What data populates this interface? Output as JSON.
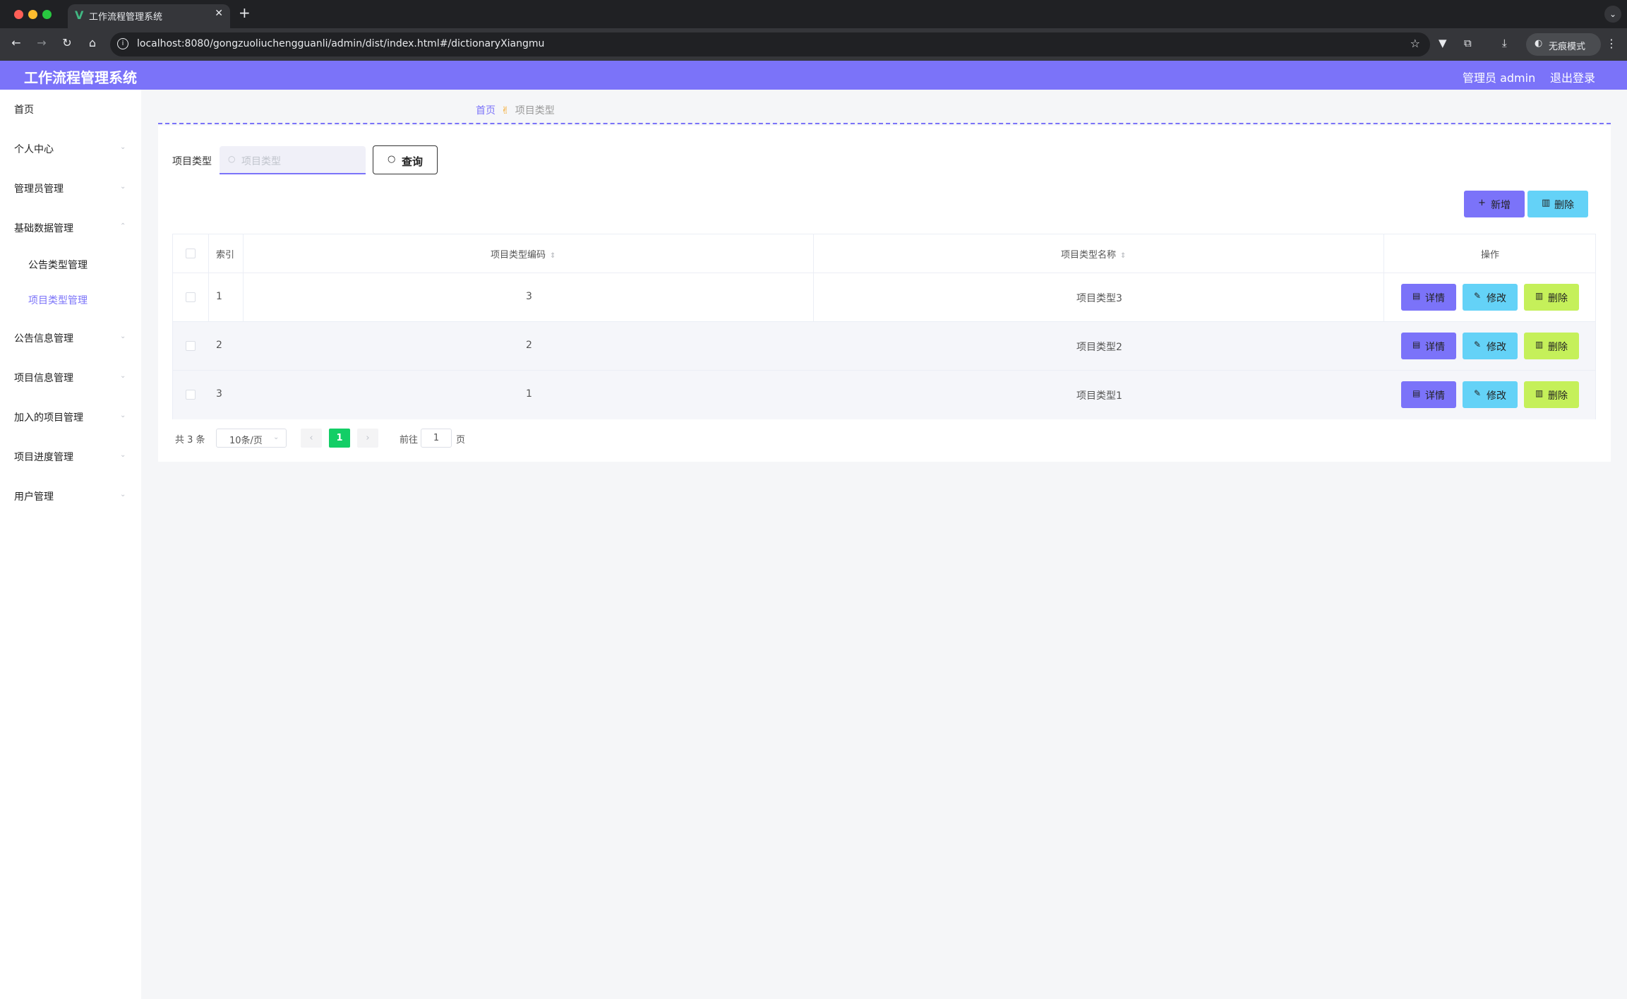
{
  "browser": {
    "tab_title": "工作流程管理系统",
    "tab_logo": "V",
    "url": "localhost:8080/gongzuoliuchengguanli/admin/dist/index.html#/dictionaryXiangmu",
    "incognito_label": "无痕模式"
  },
  "header": {
    "title": "工作流程管理系统",
    "user": "管理员 admin",
    "logout": "退出登录",
    "color": "#7b73f9"
  },
  "sidebar": {
    "items": [
      {
        "label": "首页"
      },
      {
        "label": "个人中心"
      },
      {
        "label": "管理员管理"
      },
      {
        "label": "基础数据管理",
        "expanded": true
      },
      {
        "label": "公告信息管理"
      },
      {
        "label": "项目信息管理"
      },
      {
        "label": "加入的项目管理"
      },
      {
        "label": "项目进度管理"
      },
      {
        "label": "用户管理"
      }
    ],
    "sub_items": [
      {
        "label": "公告类型管理"
      },
      {
        "label": "项目类型管理",
        "active": true
      }
    ]
  },
  "breadcrumb": {
    "home": "首页",
    "separator": "✌",
    "current": "项目类型"
  },
  "search": {
    "label": "项目类型",
    "placeholder": "项目类型",
    "button": "查询"
  },
  "toolbar": {
    "add_label": "新增",
    "delete_label": "删除"
  },
  "table": {
    "columns": [
      "索引",
      "项目类型编码",
      "项目类型名称",
      "操作"
    ],
    "rows": [
      {
        "index": "1",
        "code": "3",
        "name": "项目类型3"
      },
      {
        "index": "2",
        "code": "2",
        "name": "项目类型2"
      },
      {
        "index": "3",
        "code": "1",
        "name": "项目类型1"
      }
    ],
    "actions": {
      "detail": "详情",
      "edit": "修改",
      "delete": "删除"
    }
  },
  "pagination": {
    "total": "共 3 条",
    "page_size": "10条/页",
    "current_page": "1",
    "goto_prefix": "前往",
    "goto_value": "1",
    "goto_suffix": "页"
  },
  "colors": {
    "primary": "#7b73f9",
    "info": "#64d2f7",
    "lime": "#c5f05a",
    "page_active": "#13ce66"
  }
}
